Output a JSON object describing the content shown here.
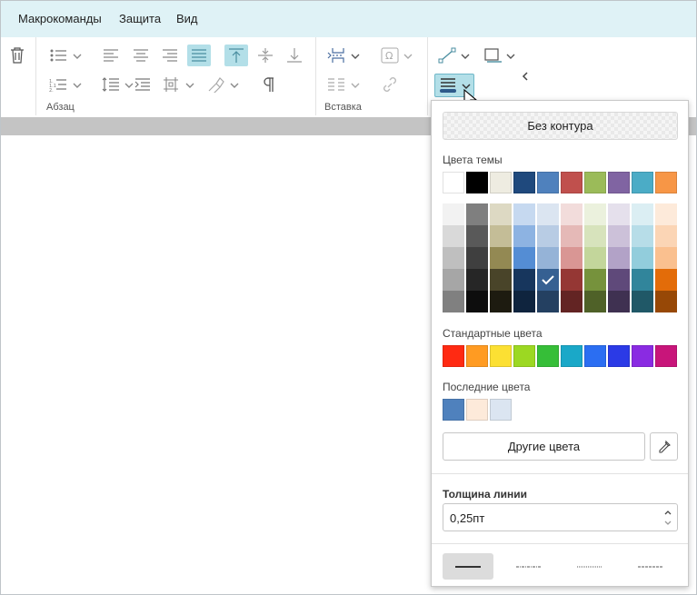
{
  "menu": {
    "items": [
      "Макрокоманды",
      "Защита",
      "Вид"
    ]
  },
  "ribbon": {
    "groups": {
      "paragraph": "Абзац",
      "insert": "Вставка"
    },
    "accent": "#b3dfe8"
  },
  "outline_dropdown": {
    "no_outline": "Без контура",
    "theme_colors_label": "Цвета темы",
    "theme_colors": [
      "#ffffff",
      "#000000",
      "#eeece1",
      "#1f497d",
      "#4f81bd",
      "#c0504d",
      "#9bbb59",
      "#8064a2",
      "#4bacc6",
      "#f79646"
    ],
    "theme_shades": [
      [
        "#f2f2f2",
        "#d9d9d9",
        "#bfbfbf",
        "#a6a6a6",
        "#808080"
      ],
      [
        "#7f7f7f",
        "#595959",
        "#3f3f3f",
        "#262626",
        "#0d0d0d"
      ],
      [
        "#ddd9c3",
        "#c4bd97",
        "#938953",
        "#494429",
        "#1d1b10"
      ],
      [
        "#c6d9f0",
        "#8db3e2",
        "#548dd4",
        "#17365d",
        "#0f243e"
      ],
      [
        "#dbe5f1",
        "#b8cce4",
        "#95b3d7",
        "#366092",
        "#244061"
      ],
      [
        "#f2dcdb",
        "#e5b9b7",
        "#d99694",
        "#953734",
        "#632423"
      ],
      [
        "#ebf1dd",
        "#d7e3bc",
        "#c3d69b",
        "#76923c",
        "#4f6128"
      ],
      [
        "#e5e0ec",
        "#ccc1d9",
        "#b2a2c7",
        "#5f497a",
        "#3f3151"
      ],
      [
        "#dbeef3",
        "#b7dde8",
        "#92cddc",
        "#31859b",
        "#205867"
      ],
      [
        "#fdeada",
        "#fbd5b5",
        "#fac08f",
        "#e36c09",
        "#974806"
      ]
    ],
    "selected_shade": {
      "column": 4,
      "row": 3
    },
    "standard_colors_label": "Стандартные цвета",
    "standard_colors": [
      "#ff2a12",
      "#ff9b22",
      "#fce033",
      "#9cd822",
      "#36be38",
      "#1aa8c8",
      "#2b6ef2",
      "#2b3ae6",
      "#8a2be2",
      "#c8157a"
    ],
    "recent_colors_label": "Последние цвета",
    "recent_colors": [
      "#4f81bd",
      "#fdeada",
      "#dbe5f1"
    ],
    "more_colors": "Другие цвета",
    "line_width_label": "Толщина линии",
    "line_width_value": "0,25пт",
    "line_styles": [
      "solid",
      "dash-dot",
      "dotted",
      "dashed"
    ],
    "active_line_style": "solid"
  }
}
